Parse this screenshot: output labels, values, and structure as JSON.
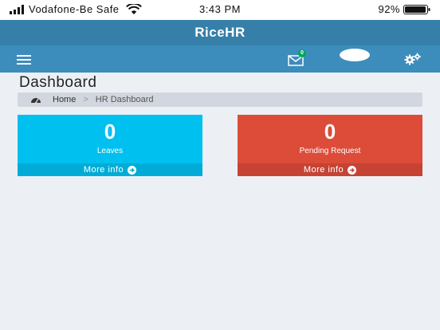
{
  "status_bar": {
    "carrier": "Vodafone-Be Safe",
    "time": "3:43 PM",
    "battery": "92%"
  },
  "app": {
    "title": "RiceHR"
  },
  "navbar": {
    "mail_badge": "0",
    "icons": [
      "hamburger-icon",
      "mail-icon",
      "avatar",
      "gears-icon"
    ]
  },
  "page": {
    "title": "Dashboard",
    "breadcrumb": {
      "home": "Home",
      "separator": ">",
      "current": "HR Dashboard"
    }
  },
  "tiles": [
    {
      "count": "0",
      "label": "Leaves",
      "footer": "More info",
      "color": "#00c0ef"
    },
    {
      "count": "0",
      "label": "Pending Request",
      "footer": "More info",
      "color": "#dd4b39"
    }
  ]
}
